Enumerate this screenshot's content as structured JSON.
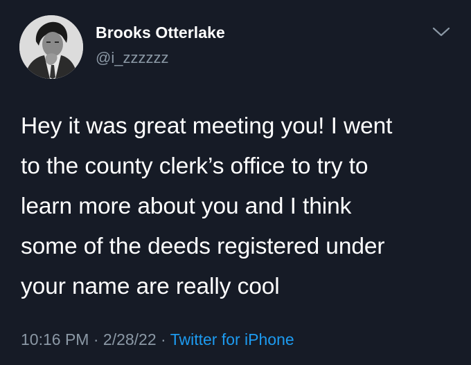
{
  "author": {
    "display_name": "Brooks Otterlake",
    "handle": "@i_zzzzzz"
  },
  "tweet": {
    "lines": [
      "Hey it was great meeting you! I went",
      "to the county clerk’s office to try to",
      "learn more about you and I think",
      "some of the deeds registered under",
      "your name are really cool"
    ],
    "time": "10:16 PM",
    "date": "2/28/22",
    "source": "Twitter for iPhone",
    "separator": "·"
  },
  "icons": {
    "menu": "chevron-down-icon",
    "avatar": "avatar"
  },
  "colors": {
    "background": "#161b26",
    "text": "#ffffff",
    "secondary": "#8b98a5",
    "link": "#1d9bf0"
  }
}
